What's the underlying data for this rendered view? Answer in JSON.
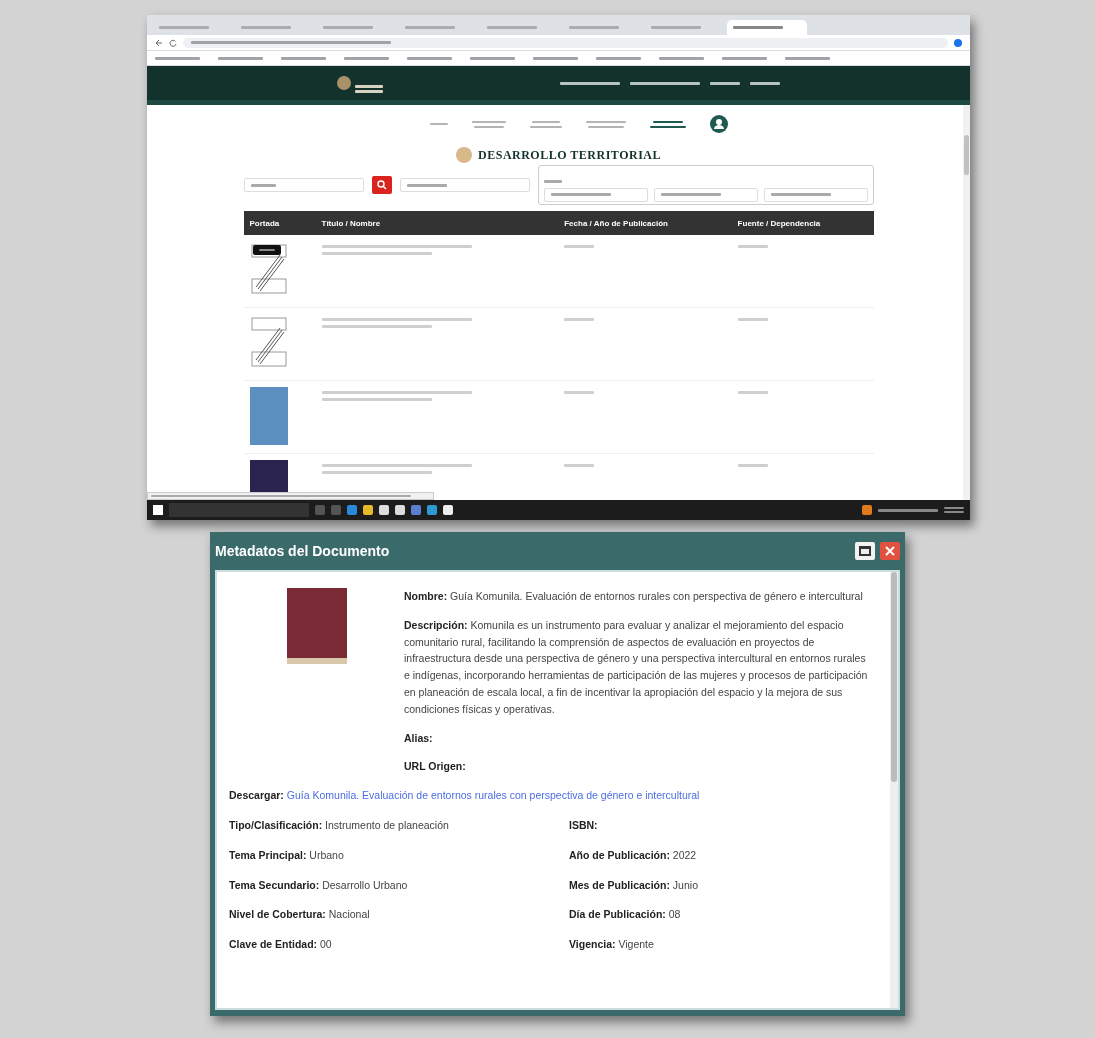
{
  "browser": {
    "tabs": [
      {
        "selected": false
      },
      {
        "selected": false
      },
      {
        "selected": false
      },
      {
        "selected": false
      },
      {
        "selected": false
      },
      {
        "selected": false
      },
      {
        "selected": false
      },
      {
        "selected": true
      }
    ],
    "page_title": "DESARROLLO TERRITORIAL",
    "table": {
      "columns": [
        "Portada",
        "Título / Nombre",
        "Fecha / Año de Publicación",
        "Fuente / Dependencia"
      ],
      "rows": [
        {
          "kind": "sketch",
          "tooltip": true
        },
        {
          "kind": "sketch",
          "tooltip": false
        },
        {
          "kind": "photo",
          "color": "#5b8fc0"
        },
        {
          "kind": "photo",
          "color": "#2a2350"
        }
      ]
    }
  },
  "dialog": {
    "title": "Metadatos del Documento",
    "name": "**Nombre:** Guía Komunila. Evaluación de entornos rurales con perspectiva de género e intercultural",
    "description": "**Descripción:** Komunila es un instrumento para evaluar y analizar el mejoramiento del espacio comunitario rural, facilitando la comprensión de aspectos de evaluación en proyectos de infraestructura desde una perspectiva de género y una perspectiva intercultural en entornos rurales e indígenas, incorporando herramientas de participación de las mujeres y procesos de participación en planeación de escala local, a fin de incentivar la apropiación del espacio y la mejora de sus condiciones físicas y operativas.",
    "alias": "Alias:",
    "url_origin": "URL Origen:",
    "download_label": "Descargar:",
    "download_link": "Guía Komunila. Evaluación de entornos rurales con perspectiva de género e intercultural",
    "fields": [
      "**Tipo/Clasificación:** Instrumento de planeación",
      "**ISBN:**",
      "**Tema Principal:** Urbano",
      "**Año de Publicación:** 2022",
      "**Tema Secundario:** Desarrollo Urbano",
      "**Mes de Publicación:** Junio",
      "**Nivel de Cobertura:** Nacional",
      "**Día de Publicación:** 08",
      "**Clave de Entidad:** 00",
      "**Vigencia:** Vigente"
    ]
  }
}
